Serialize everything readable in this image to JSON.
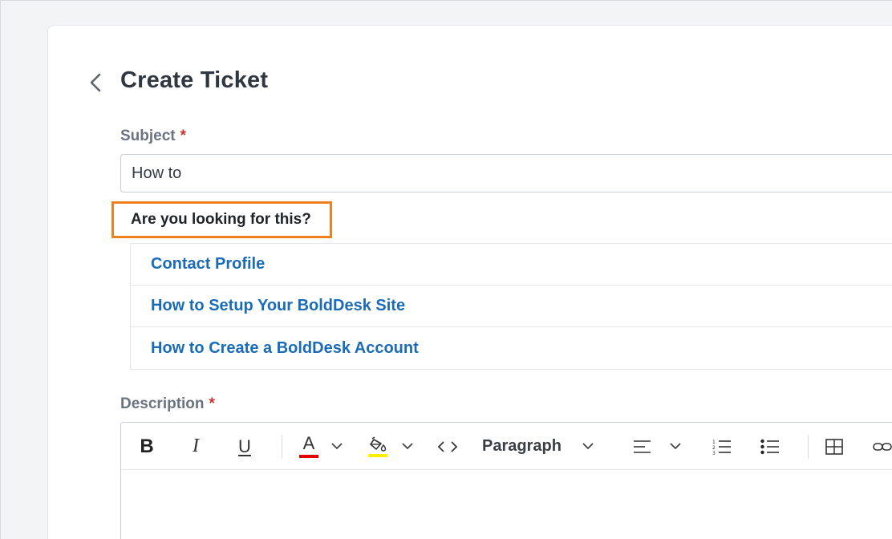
{
  "header": {
    "title": "Create Ticket",
    "back_icon": "chevron-left-icon"
  },
  "subject": {
    "label": "Subject",
    "required_mark": "*",
    "value": "How to"
  },
  "suggestions": {
    "heading": "Are you looking for this?",
    "highlight_color": "#f0801d",
    "items": [
      {
        "label": "Contact Profile"
      },
      {
        "label": "How to Setup Your BoldDesk Site"
      },
      {
        "label": "How to Create a BoldDesk Account"
      }
    ]
  },
  "description": {
    "label": "Description",
    "required_mark": "*"
  },
  "toolbar": {
    "bold": "B",
    "italic": "I",
    "underline": "U",
    "font_color_glyph": "A",
    "font_color": "#e00000",
    "highlight_color": "#ffee00",
    "format_value": "Paragraph",
    "icons": [
      "bold-icon",
      "italic-icon",
      "underline-icon",
      "font-color-icon",
      "background-color-icon",
      "code-icon",
      "paragraph-format-dropdown",
      "align-left-icon",
      "ordered-list-icon",
      "unordered-list-icon",
      "table-icon",
      "link-icon"
    ]
  },
  "colors": {
    "link": "#1a6bb8",
    "required": "#d32f2f",
    "title": "#2f3640"
  }
}
